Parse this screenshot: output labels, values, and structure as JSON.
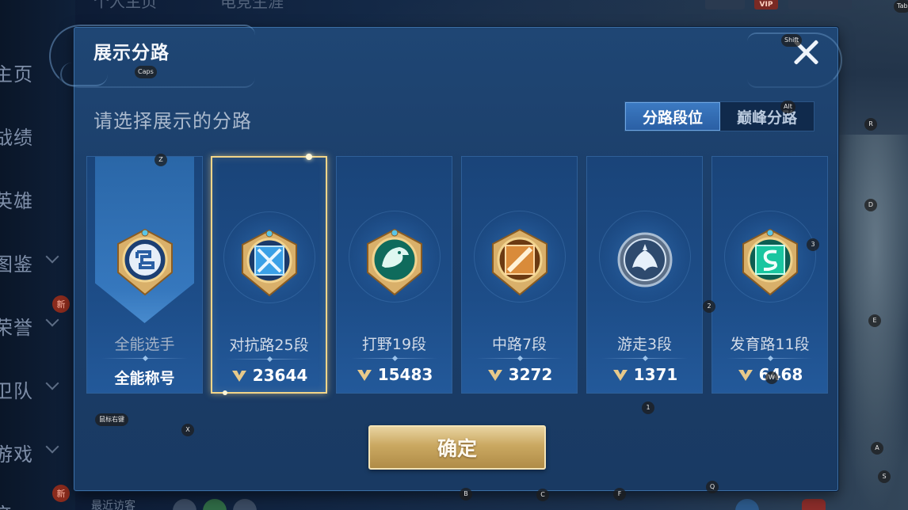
{
  "background": {
    "top_tabs": [
      "个人主页",
      "电竞生涯"
    ],
    "nav_items": [
      "主页",
      "战绩",
      "英雄",
      "图鉴",
      "荣誉",
      "卫队",
      "游戏",
      "亲"
    ],
    "badges": [
      "新",
      "新"
    ],
    "vip": "VIP",
    "bottom_text": "最近访客"
  },
  "dialog": {
    "title": "展示分路",
    "subtitle": "请选择展示的分路",
    "tabs": [
      {
        "label": "分路段位",
        "active": true
      },
      {
        "label": "巅峰分路",
        "active": false
      }
    ],
    "confirm_label": "确定"
  },
  "cards": [
    {
      "name": "全能选手",
      "score_label": "全能称号",
      "score": null,
      "emblem": "generic-role-emblem",
      "selected": false,
      "color": "#c9d6e6"
    },
    {
      "name": "对抗路25段",
      "score_label": null,
      "score": "23644",
      "emblem": "clash-lane-emblem",
      "selected": true,
      "color": "#3aa0e6"
    },
    {
      "name": "打野19段",
      "score_label": null,
      "score": "15483",
      "emblem": "jungle-dragon-emblem",
      "selected": false,
      "color": "#17b08f"
    },
    {
      "name": "中路7段",
      "score_label": null,
      "score": "3272",
      "emblem": "mid-lane-emblem",
      "selected": false,
      "color": "#d98b3a"
    },
    {
      "name": "游走3段",
      "score_label": null,
      "score": "1371",
      "emblem": "roam-wings-emblem",
      "selected": false,
      "color": "#8fa9c4"
    },
    {
      "name": "发育路11段",
      "score_label": null,
      "score": "6468",
      "emblem": "farm-lane-emblem",
      "selected": false,
      "color": "#19c6a0"
    }
  ],
  "key_hints": [
    "Caps",
    "Shift",
    "Alt",
    "Tab",
    "Z",
    "X",
    "R",
    "D",
    "E",
    "3",
    "2",
    "1",
    "W",
    "A",
    "S",
    "B",
    "C",
    "F",
    "Q",
    "鼠标右键"
  ]
}
